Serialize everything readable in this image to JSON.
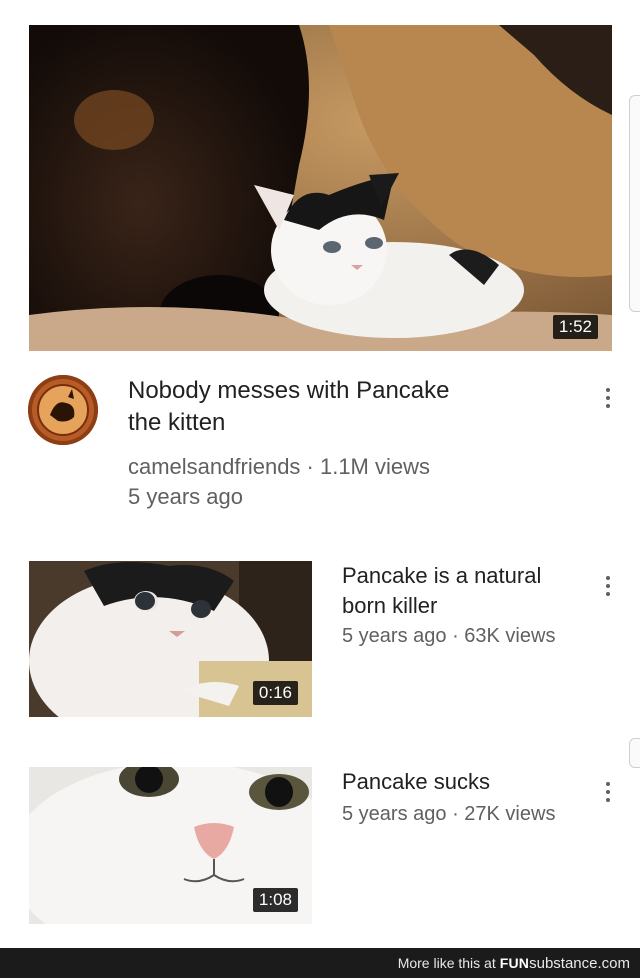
{
  "featured": {
    "duration": "1:52",
    "title_line1": "Nobody messes with Pancake",
    "title_line2": "the kitten",
    "channel_views": "camelsandfriends · 1.1M views",
    "age": "5 years ago"
  },
  "related": [
    {
      "title_line1": "Pancake is a natural",
      "title_line2": "born killer",
      "meta": "5 years ago · 63K views",
      "duration": "0:16"
    },
    {
      "title_line1": "Pancake sucks",
      "meta": "5 years ago · 27K views",
      "duration": "1:08"
    }
  ],
  "footer": {
    "prefix": "More like this at",
    "brand_bold": "FUN",
    "brand_rest": "substance.com"
  },
  "icons": [
    "more-vert-icon",
    "channel-avatar"
  ],
  "colors": {
    "text": "#212121",
    "meta": "#606060",
    "footer_bg": "#1b1b1b"
  }
}
